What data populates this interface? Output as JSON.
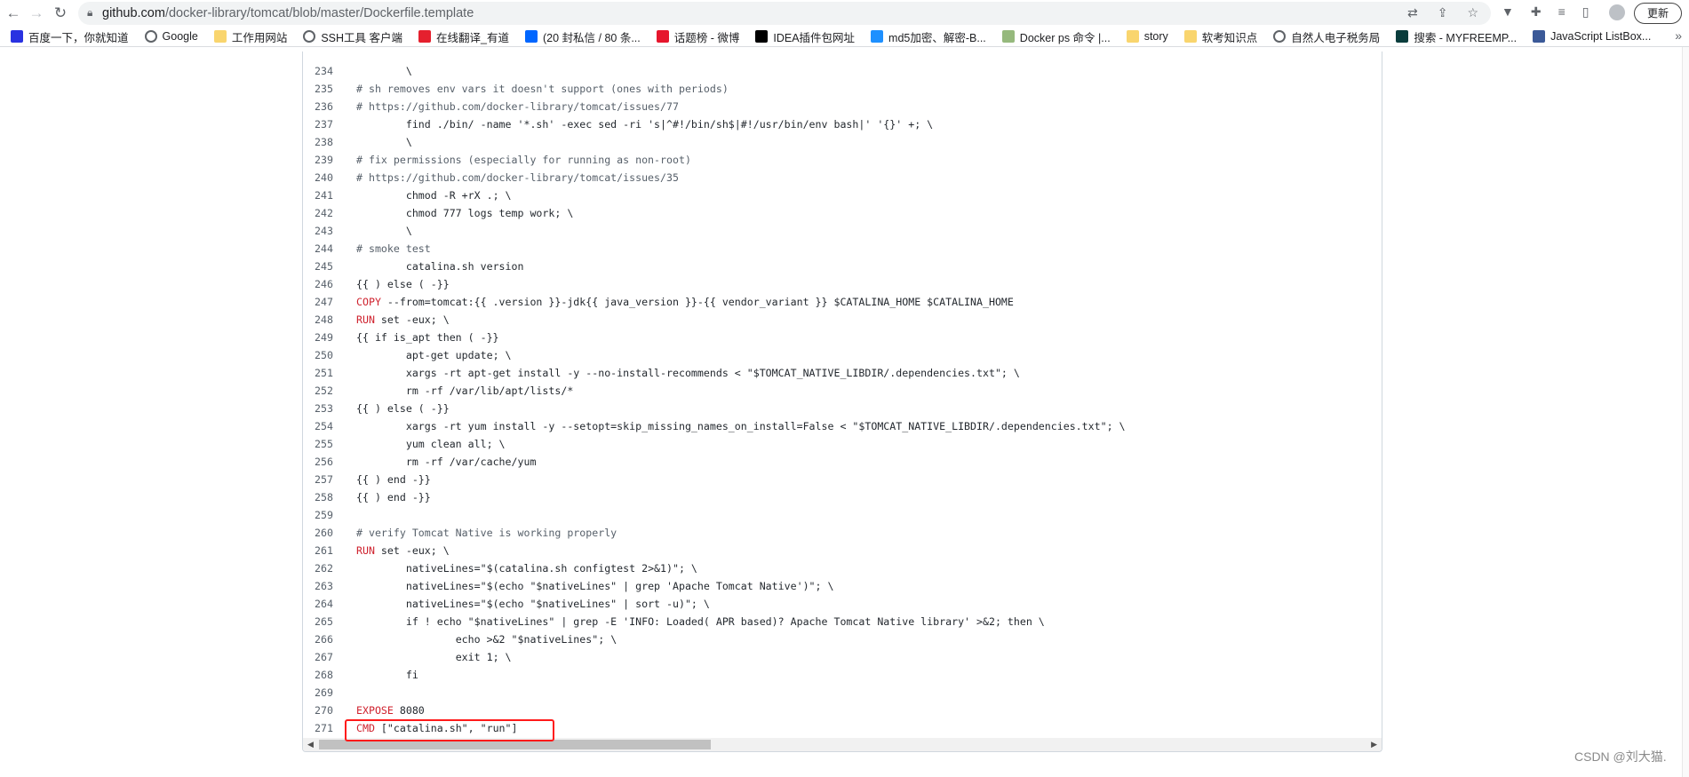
{
  "browser": {
    "url_host": "github.com",
    "url_path": "/docker-library/tomcat/blob/master/Dockerfile.template",
    "update_label": "更新",
    "bookmarks": [
      {
        "label": "百度一下，你就知道",
        "icon": "baidu-paw-icon",
        "color": "#2932e1"
      },
      {
        "label": "Google",
        "icon": "globe-icon",
        "color": "#5f6368"
      },
      {
        "label": "工作用网站",
        "icon": "folder-icon",
        "color": "#f9d56e"
      },
      {
        "label": "SSH工具 客户端",
        "icon": "globe-icon",
        "color": "#5f6368"
      },
      {
        "label": "在线翻译_有道",
        "icon": "youdao-icon",
        "color": "#e5202e"
      },
      {
        "label": "(20 封私信 / 80 条...",
        "icon": "zhihu-icon",
        "color": "#0066ff"
      },
      {
        "label": "话题榜 - 微博",
        "icon": "weibo-icon",
        "color": "#e6162d"
      },
      {
        "label": "IDEA插件包网址",
        "icon": "jetbrains-icon",
        "color": "#000000"
      },
      {
        "label": "md5加密、解密-B...",
        "icon": "b-icon",
        "color": "#1e90ff"
      },
      {
        "label": "Docker ps 命令 |...",
        "icon": "runoob-icon",
        "color": "#96b97d"
      },
      {
        "label": "story",
        "icon": "folder-icon",
        "color": "#f9d56e"
      },
      {
        "label": "软考知识点",
        "icon": "folder-icon",
        "color": "#f9d56e"
      },
      {
        "label": "自然人电子税务局",
        "icon": "globe-icon",
        "color": "#5f6368"
      },
      {
        "label": "搜索 - MYFREEMP...",
        "icon": "myfreemp3-icon",
        "color": "#0a3d3d"
      },
      {
        "label": "JavaScript ListBox...",
        "icon": "grid-icon",
        "color": "#3b5998"
      }
    ]
  },
  "code": {
    "keyword_color": "#cf222e",
    "highlight_color": "#ff1a1a",
    "lines": [
      {
        "n": "234",
        "kw": "",
        "text": "\t\\",
        "comment": false
      },
      {
        "n": "235",
        "kw": "",
        "text": "# sh removes env vars it doesn't support (ones with periods)",
        "comment": true
      },
      {
        "n": "236",
        "kw": "",
        "text": "# https://github.com/docker-library/tomcat/issues/77",
        "comment": true
      },
      {
        "n": "237",
        "kw": "",
        "text": "\tfind ./bin/ -name '*.sh' -exec sed -ri 's|^#!/bin/sh$|#!/usr/bin/env bash|' '{}' +; \\",
        "comment": false
      },
      {
        "n": "238",
        "kw": "",
        "text": "\t\\",
        "comment": false
      },
      {
        "n": "239",
        "kw": "",
        "text": "# fix permissions (especially for running as non-root)",
        "comment": true
      },
      {
        "n": "240",
        "kw": "",
        "text": "# https://github.com/docker-library/tomcat/issues/35",
        "comment": true
      },
      {
        "n": "241",
        "kw": "",
        "text": "\tchmod -R +rX .; \\",
        "comment": false
      },
      {
        "n": "242",
        "kw": "",
        "text": "\tchmod 777 logs temp work; \\",
        "comment": false
      },
      {
        "n": "243",
        "kw": "",
        "text": "\t\\",
        "comment": false
      },
      {
        "n": "244",
        "kw": "",
        "text": "# smoke test",
        "comment": true
      },
      {
        "n": "245",
        "kw": "",
        "text": "\tcatalina.sh version",
        "comment": false
      },
      {
        "n": "246",
        "kw": "",
        "text": "{{ ) else ( -}}",
        "comment": false
      },
      {
        "n": "247",
        "kw": "COPY",
        "text": " --from=tomcat:{{ .version }}-jdk{{ java_version }}-{{ vendor_variant }} $CATALINA_HOME $CATALINA_HOME",
        "comment": false
      },
      {
        "n": "248",
        "kw": "RUN",
        "text": " set -eux; \\",
        "comment": false
      },
      {
        "n": "249",
        "kw": "",
        "text": "{{ if is_apt then ( -}}",
        "comment": false
      },
      {
        "n": "250",
        "kw": "",
        "text": "\tapt-get update; \\",
        "comment": false
      },
      {
        "n": "251",
        "kw": "",
        "text": "\txargs -rt apt-get install -y --no-install-recommends < \"$TOMCAT_NATIVE_LIBDIR/.dependencies.txt\"; \\",
        "comment": false
      },
      {
        "n": "252",
        "kw": "",
        "text": "\trm -rf /var/lib/apt/lists/*",
        "comment": false
      },
      {
        "n": "253",
        "kw": "",
        "text": "{{ ) else ( -}}",
        "comment": false
      },
      {
        "n": "254",
        "kw": "",
        "text": "\txargs -rt yum install -y --setopt=skip_missing_names_on_install=False < \"$TOMCAT_NATIVE_LIBDIR/.dependencies.txt\"; \\",
        "comment": false
      },
      {
        "n": "255",
        "kw": "",
        "text": "\tyum clean all; \\",
        "comment": false
      },
      {
        "n": "256",
        "kw": "",
        "text": "\trm -rf /var/cache/yum",
        "comment": false
      },
      {
        "n": "257",
        "kw": "",
        "text": "{{ ) end -}}",
        "comment": false
      },
      {
        "n": "258",
        "kw": "",
        "text": "{{ ) end -}}",
        "comment": false
      },
      {
        "n": "259",
        "kw": "",
        "text": "",
        "comment": false
      },
      {
        "n": "260",
        "kw": "",
        "text": "# verify Tomcat Native is working properly",
        "comment": true
      },
      {
        "n": "261",
        "kw": "RUN",
        "text": " set -eux; \\",
        "comment": false
      },
      {
        "n": "262",
        "kw": "",
        "text": "\tnativeLines=\"$(catalina.sh configtest 2>&1)\"; \\",
        "comment": false
      },
      {
        "n": "263",
        "kw": "",
        "text": "\tnativeLines=\"$(echo \"$nativeLines\" | grep 'Apache Tomcat Native')\"; \\",
        "comment": false
      },
      {
        "n": "264",
        "kw": "",
        "text": "\tnativeLines=\"$(echo \"$nativeLines\" | sort -u)\"; \\",
        "comment": false
      },
      {
        "n": "265",
        "kw": "",
        "text": "\tif ! echo \"$nativeLines\" | grep -E 'INFO: Loaded( APR based)? Apache Tomcat Native library' >&2; then \\",
        "comment": false
      },
      {
        "n": "266",
        "kw": "",
        "text": "\t\techo >&2 \"$nativeLines\"; \\",
        "comment": false
      },
      {
        "n": "267",
        "kw": "",
        "text": "\t\texit 1; \\",
        "comment": false
      },
      {
        "n": "268",
        "kw": "",
        "text": "\tfi",
        "comment": false
      },
      {
        "n": "269",
        "kw": "",
        "text": "",
        "comment": false
      },
      {
        "n": "270",
        "kw": "EXPOSE",
        "text": " 8080",
        "comment": false
      },
      {
        "n": "271",
        "kw": "CMD",
        "text": " [\"catalina.sh\", \"run\"]",
        "comment": false
      }
    ]
  },
  "watermark": "CSDN @刘大猫."
}
